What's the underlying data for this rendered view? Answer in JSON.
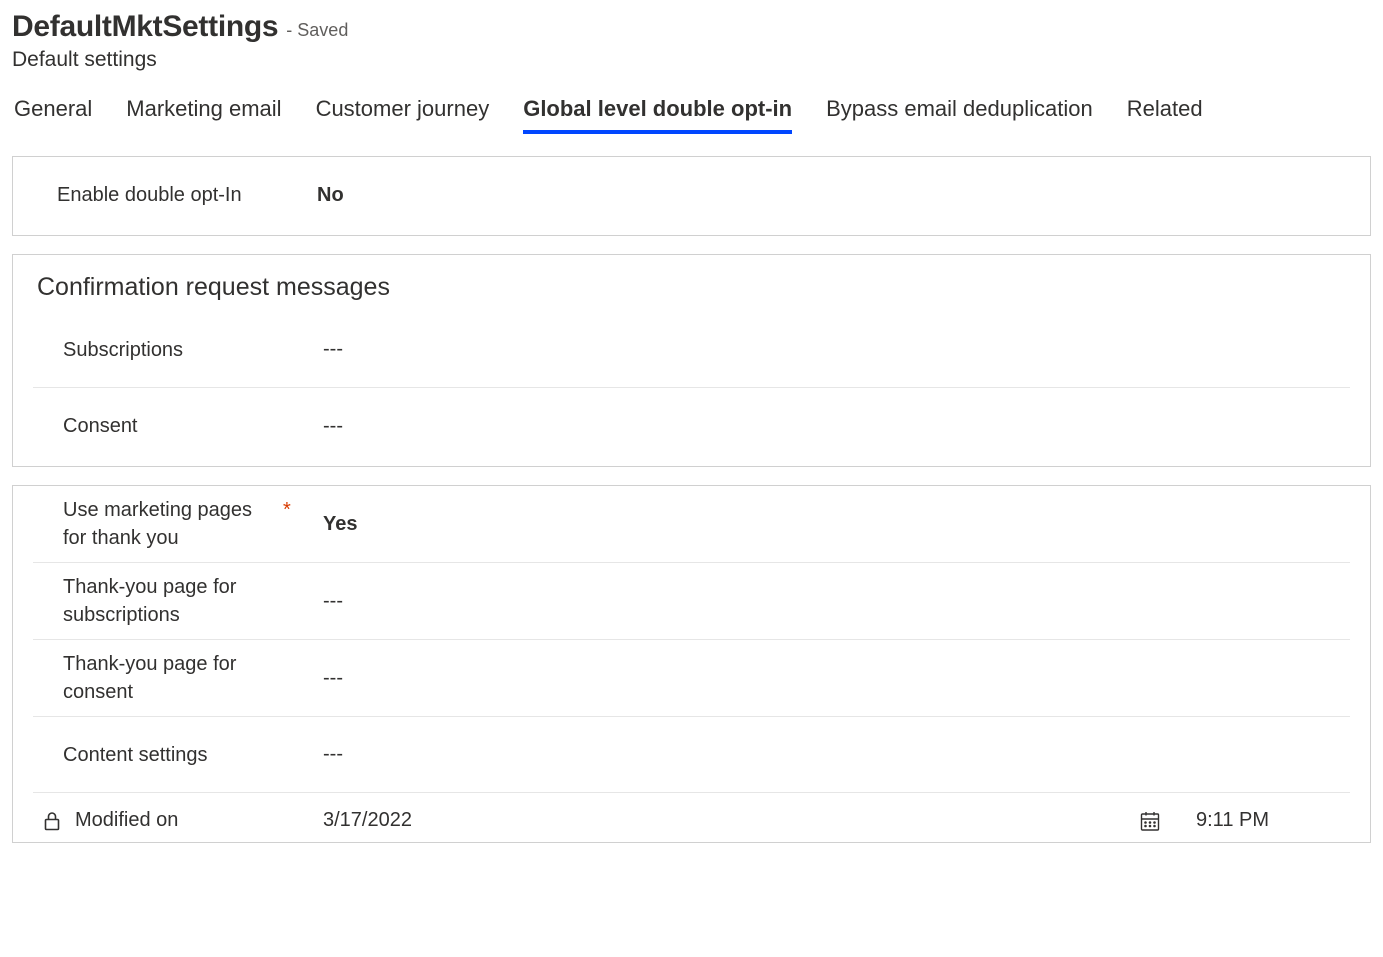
{
  "header": {
    "title": "DefaultMktSettings",
    "saveStatus": "- Saved",
    "subtitle": "Default settings"
  },
  "tabs": [
    {
      "label": "General"
    },
    {
      "label": "Marketing email"
    },
    {
      "label": "Customer journey"
    },
    {
      "label": "Global level double opt-in"
    },
    {
      "label": "Bypass email deduplication"
    },
    {
      "label": "Related"
    }
  ],
  "section1": {
    "rows": [
      {
        "label": "Enable double opt-In",
        "value": "No",
        "bold": true
      }
    ]
  },
  "section2": {
    "heading": "Confirmation request messages",
    "rows": [
      {
        "label": "Subscriptions",
        "value": "---"
      },
      {
        "label": "Consent",
        "value": "---"
      }
    ]
  },
  "section3": {
    "rows": [
      {
        "label": "Use marketing pages for thank you",
        "value": "Yes",
        "required": true,
        "bold": true
      },
      {
        "label": "Thank-you page for subscriptions",
        "value": "---"
      },
      {
        "label": "Thank-you page for consent",
        "value": "---"
      },
      {
        "label": "Content settings",
        "value": "---"
      }
    ]
  },
  "footer": {
    "label": "Modified on",
    "date": "3/17/2022",
    "time": "9:11 PM"
  }
}
